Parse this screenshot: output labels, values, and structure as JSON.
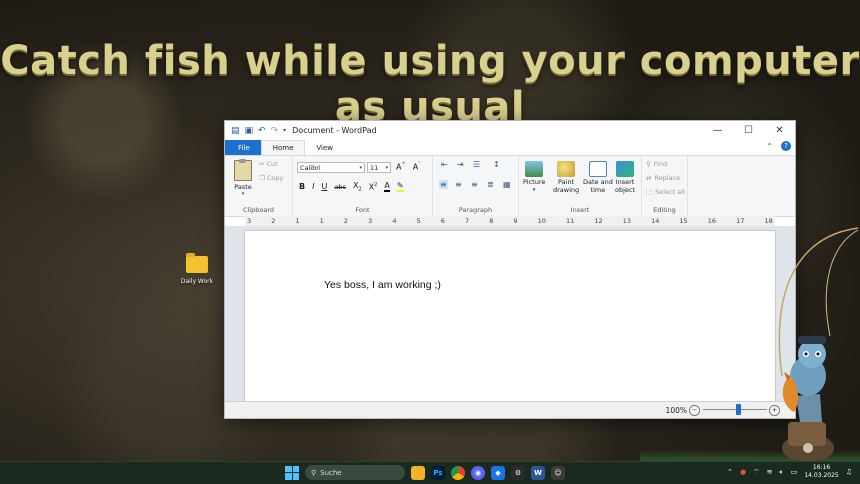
{
  "headline": "Catch fish while using your computer as usual",
  "desktop_icon": {
    "label": "Daily Work"
  },
  "window": {
    "title": "Document - WordPad",
    "tabs": [
      {
        "label": "File"
      },
      {
        "label": "Home"
      },
      {
        "label": "View"
      }
    ],
    "ribbon": {
      "clipboard": {
        "paste": "Paste",
        "cut": "Cut",
        "copy": "Copy",
        "group": "Clipboard"
      },
      "font": {
        "family": "Calibri",
        "size": "11",
        "group": "Font"
      },
      "paragraph": {
        "group": "Paragraph"
      },
      "insert": {
        "picture": "Picture",
        "paint_drawing_1": "Paint",
        "paint_drawing_2": "drawing",
        "date_time_1": "Date and",
        "date_time_2": "time",
        "insert_object_1": "Insert",
        "insert_object_2": "object",
        "group": "Insert"
      },
      "editing": {
        "find": "Find",
        "replace": "Replace",
        "select_all": "Select all",
        "group": "Editing"
      }
    },
    "ruler_labels": [
      "3",
      "2",
      "1",
      "1",
      "2",
      "3",
      "4",
      "5",
      "6",
      "7",
      "8",
      "9",
      "10",
      "11",
      "12",
      "13",
      "14",
      "15",
      "16",
      "17",
      "18"
    ],
    "document_text": "Yes boss, I am working ;)",
    "zoom": "100%"
  },
  "taskbar": {
    "search_placeholder": "Suche",
    "time": "16:16",
    "date": "14.03.2025"
  }
}
